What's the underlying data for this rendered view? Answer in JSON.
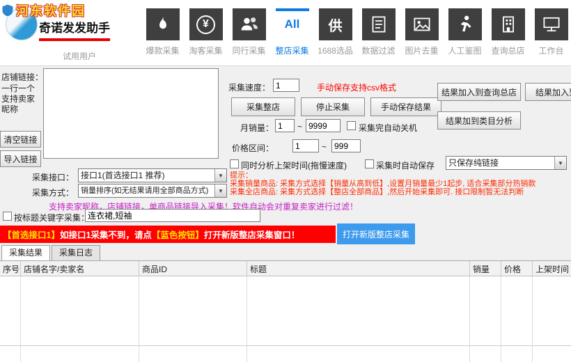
{
  "header": {
    "watermark": "河东软件园",
    "app_title": "奇诺发发助手",
    "user_status": "试用用户",
    "toolbar": [
      {
        "label": "爆款采集"
      },
      {
        "label": "淘客采集",
        "glyph": "¥"
      },
      {
        "label": "同行采集"
      },
      {
        "label": "整店采集",
        "glyph": "All"
      },
      {
        "label": "1688选品",
        "glyph": "供"
      },
      {
        "label": "数据过滤"
      },
      {
        "label": "图片去重"
      },
      {
        "label": "人工鉴图"
      },
      {
        "label": "查询总店"
      },
      {
        "label": "工作台"
      }
    ]
  },
  "shop_links": {
    "label": "店铺链接：",
    "hint_line1": "一行一个",
    "hint_line2": "支持卖家昵称",
    "textarea_value": "",
    "clear_button": "清空链接",
    "import_button": "导入链接"
  },
  "controls": {
    "speed_label": "采集速度：",
    "speed_value": "1",
    "csv_note": "手动保存支持csv格式",
    "start_button": "采集整店",
    "stop_button": "停止采集",
    "manual_save_button": "手动保存结果",
    "monthly_label": "月销量：",
    "monthly_min": "1",
    "range_tilde": "~",
    "monthly_max": "9999",
    "shutdown_label": "采集完自动关机",
    "price_label": "价格区间：",
    "price_min": "1",
    "price_max": "999",
    "analyze_label": "同时分析上架时间(拖慢速度)",
    "autosave_label": "采集时自动保存",
    "save_mode_value": "只保存纯链接"
  },
  "results_buttons": {
    "add_to_query": "结果加入到查询总店",
    "add_to_other": "结果加入到",
    "add_to_category": "结果加到类目分析"
  },
  "tips": {
    "title": "提示：",
    "line1": "采集销量商品: 采集方式选择【销量从高到低】,设置月销量最少1起步, 适合采集部分热销款",
    "line2": "采集全店商品: 采集方式选择【整店全部商品】,然后开始采集即可. 接口限制暂无法判断"
  },
  "interface": {
    "api_label": "采集接口：",
    "api_value": "接口1(首选接口1 推荐)",
    "mode_label": "采集方式：",
    "mode_value": "销量排序(如无结果请用全部商品方式)"
  },
  "notes": {
    "purple_note": "支持卖家昵称，店铺链接，单商品链接导入采集！软件自动会对重复卖家进行过滤！"
  },
  "keyword": {
    "label": "按标题关键字采集：",
    "value": "连衣裙,短袖"
  },
  "banner": {
    "part1": "【首选接口1】",
    "part2": "如接口1采集不到，请点",
    "part3": "【蓝色按钮】",
    "part4": "打开新版整店采集窗口！",
    "open_button": "打开新版整店采集"
  },
  "tabs": [
    {
      "label": "采集结果"
    },
    {
      "label": "采集日志"
    }
  ],
  "table": {
    "headers": [
      "序号",
      "店铺名字/卖家名",
      "商品ID",
      "标题",
      "销量",
      "价格",
      "上架时间"
    ],
    "rows": []
  },
  "colors": {
    "accent_blue": "#0f7ae5",
    "alert_red": "#ff0000",
    "tip_red": "#ff2a00",
    "purple": "#c520c5",
    "banner_red": "#ff0000",
    "button_blue": "#3d9bee"
  }
}
